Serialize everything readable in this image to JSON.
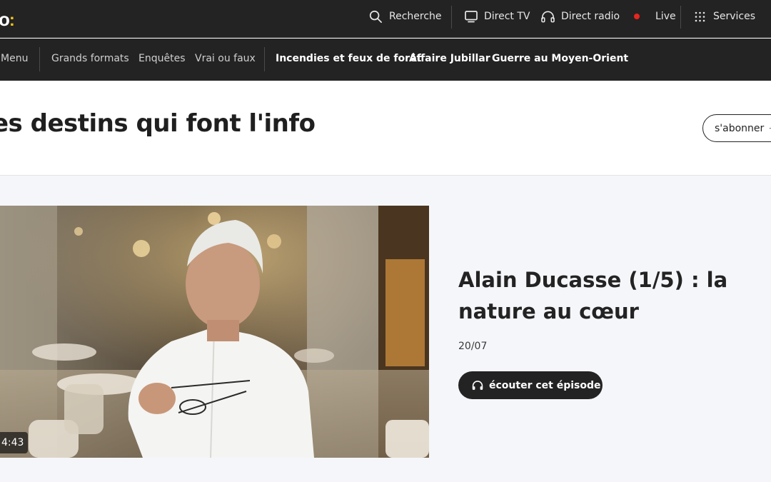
{
  "header": {
    "logo_text": "o",
    "logo_dots": ":",
    "search_label": "Recherche",
    "direct_tv_label": "Direct TV",
    "direct_radio_label": "Direct radio",
    "live_label": "Live",
    "services_label": "Services"
  },
  "subnav": {
    "menu_label": "Menu",
    "items": [
      "Grands formats",
      "Enquêtes",
      "Vrai ou faux"
    ],
    "topics": [
      "Incendies et feux de forêt",
      "Affaire Jubillar",
      "Guerre au Moyen-Orient"
    ]
  },
  "page": {
    "title": "es destins qui font l'info",
    "subscribe_label": "s'abonner"
  },
  "episode": {
    "title": "Alain Ducasse (1/5) : la nature au cœur",
    "date": "20/07",
    "duration": "4:43",
    "listen_label": "écouter cet épisode"
  },
  "colors": {
    "topbar_bg": "#232323",
    "accent_yellow": "#f5c518",
    "live_red": "#e5261f",
    "page_bg": "#f5f6fa"
  },
  "icons": {
    "search": "search-icon",
    "tv": "tv-icon",
    "radio": "headphones-icon",
    "live": "live-dot-icon",
    "services": "grid-icon",
    "listen": "headphones-icon"
  }
}
